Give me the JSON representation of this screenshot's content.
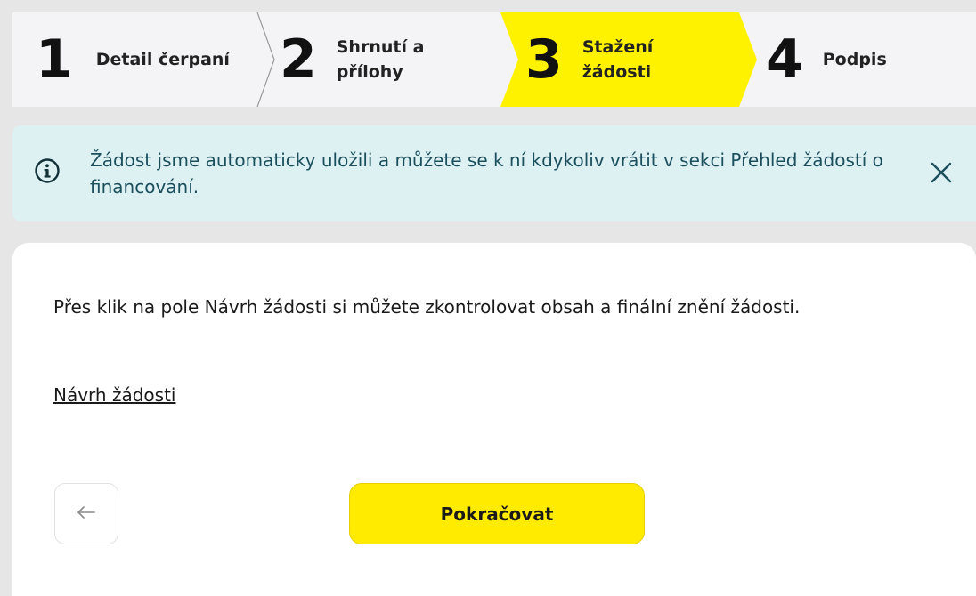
{
  "stepper": {
    "steps": [
      {
        "number": "1",
        "label": "Detail čerpaní"
      },
      {
        "number": "2",
        "label": "Shrnutí a přílohy"
      },
      {
        "number": "3",
        "label": "Stažení žádosti"
      },
      {
        "number": "4",
        "label": "Podpis"
      }
    ],
    "active_step": 3,
    "active_color": "#FFF200"
  },
  "alert": {
    "text": "Žádost jsme automaticky uložili a můžete se k ní kdykoliv vrátit v sekci  Přehled žádostí o financování.",
    "icon": "info-icon",
    "close_icon": "close-icon",
    "color": "#1B4F5D",
    "background": "#DDF0F2"
  },
  "main": {
    "instruction": "Přes klik na pole Návrh žádosti si můžete zkontrolovat obsah a finální znění žádosti.",
    "draft_link": "Návrh žádosti",
    "back_icon": "arrow-left-icon",
    "continue_label": "Pokračovat",
    "accent": "#FFEB00"
  }
}
